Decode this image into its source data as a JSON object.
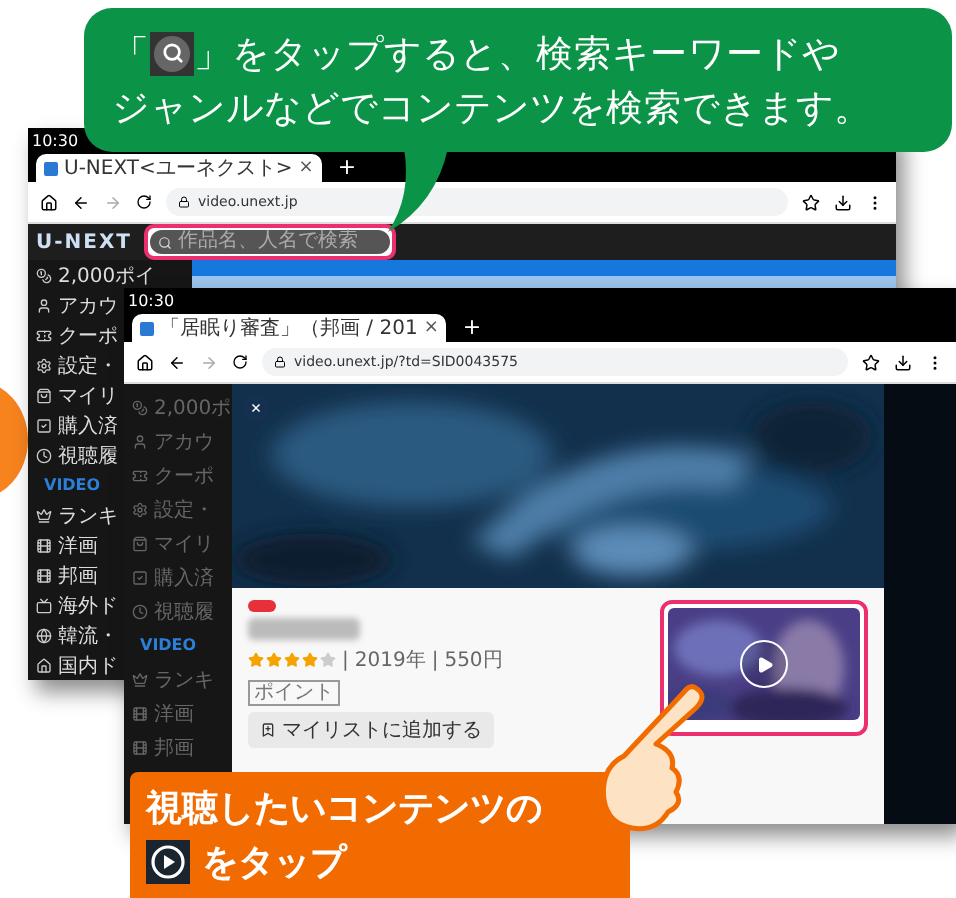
{
  "top_callout": {
    "before_icon": "「",
    "after_icon": "」をタップすると、検索キーワードや",
    "line_2": "ジャンルなどでコンテンツを検索できます。"
  },
  "back_window": {
    "time": "10:30",
    "tab_title": "U-NEXT<ユーネクスト>",
    "tab_close": "×",
    "new_tab": "+",
    "url": "video.unext.jp",
    "logo": "U-NEXT",
    "search": {
      "placeholder": "作品名、人名で検索",
      "highlighted": true
    },
    "sidebar": [
      {
        "kind": "points",
        "label": "2,000ポイ"
      },
      {
        "kind": "item",
        "label": "アカウ"
      },
      {
        "kind": "item",
        "label": "クーポ"
      },
      {
        "kind": "item",
        "label": "設定・"
      },
      {
        "kind": "item",
        "label": "マイリ"
      },
      {
        "kind": "item",
        "label": "購入済"
      },
      {
        "kind": "item",
        "label": "視聴履"
      },
      {
        "kind": "section",
        "label": "VIDEO"
      },
      {
        "kind": "item",
        "label": "ランキ"
      },
      {
        "kind": "item",
        "label": "洋画"
      },
      {
        "kind": "item",
        "label": "邦画"
      },
      {
        "kind": "item",
        "label": "海外ド"
      },
      {
        "kind": "item",
        "label": "韓流・"
      },
      {
        "kind": "item",
        "label": "国内ド"
      }
    ]
  },
  "front_window": {
    "time": "10:30",
    "tab_title": "「居眠り審査」（邦画 / 201",
    "tab_close": "×",
    "new_tab": "+",
    "url": "video.unext.jp/?td=SID0043575",
    "sidebar": [
      {
        "kind": "points",
        "label": "2,000ポ"
      },
      {
        "kind": "item",
        "label": "アカウ"
      },
      {
        "kind": "item",
        "label": "クーポ"
      },
      {
        "kind": "item",
        "label": "設定・"
      },
      {
        "kind": "item",
        "label": "マイリ"
      },
      {
        "kind": "item",
        "label": "購入済"
      },
      {
        "kind": "item",
        "label": "視聴履"
      },
      {
        "kind": "section",
        "label": "VIDEO"
      },
      {
        "kind": "item",
        "label": "ランキ"
      },
      {
        "kind": "item",
        "label": "洋画"
      },
      {
        "kind": "item",
        "label": "邦画"
      }
    ],
    "modal": {
      "close": "×",
      "stars": 4,
      "year": "2019年",
      "separator": "|",
      "price": "550円",
      "tag": "ポイント",
      "mylist_button": "マイリストに追加する",
      "thumbnail_highlighted": true
    }
  },
  "bottom_callout": {
    "line_1": "視聴したいコンテンツの",
    "line_2": "をタップ"
  }
}
